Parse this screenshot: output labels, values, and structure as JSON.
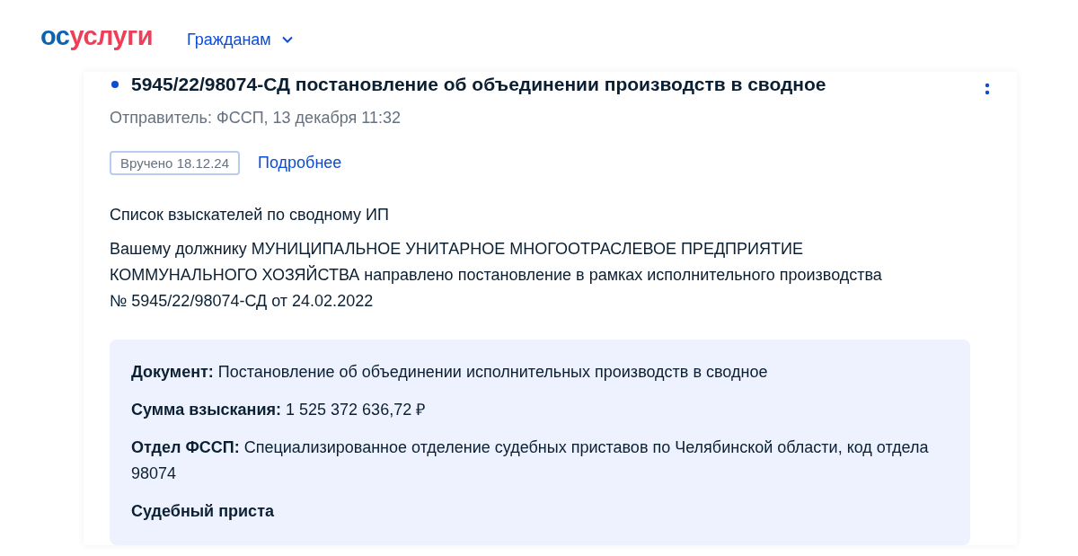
{
  "header": {
    "logo": {
      "part_1": "ос",
      "part_2": "услуги"
    },
    "nav": {
      "label": "Гражданам",
      "expanded": false
    }
  },
  "message": {
    "unread": true,
    "title": "5945/22/98074-СД постановление об объединении производств в сводное",
    "sender": "Отправитель: ФССП, 13 декабря 11:32",
    "badge": "Вручено 18.12.24",
    "details_link": "Подробнее",
    "subject": "Список взыскателей по сводному ИП",
    "body": "Вашему должнику МУНИЦИПАЛЬНОЕ УНИТАРНОЕ МНОГООТРАСЛЕВОЕ ПРЕДПРИЯТИЕ КОММУНАЛЬНОГО ХОЗЯЙСТВА направлено постановление в рамках исполнительного производства № 5945/22/98074-СД от 24.02.2022",
    "fields": [
      {
        "text": "**Документ:** Постановление об объединении исполнительных производств в сводное"
      },
      {
        "text": "**Сумма взыскания:** 1 525 372 636,72 ₽"
      },
      {
        "text": "**Отдел ФССП:** Специализированное отделение судебных приставов по Челябинской области, код отдела 98074"
      },
      {
        "text": "**Судебный приста**"
      }
    ]
  }
}
